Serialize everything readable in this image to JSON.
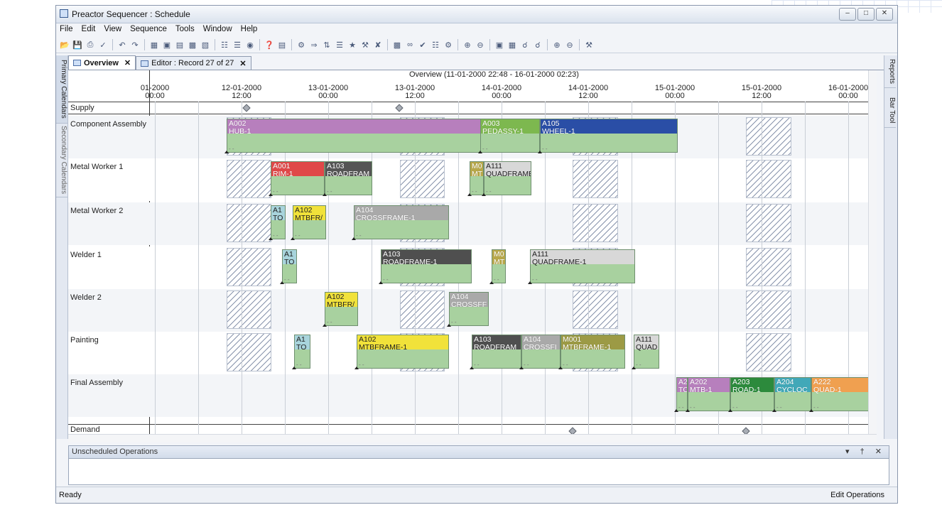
{
  "window": {
    "title": "Preactor Sequencer : Schedule",
    "controls": [
      "–",
      "□",
      "✕"
    ]
  },
  "menu": [
    "File",
    "Edit",
    "View",
    "Sequence",
    "Tools",
    "Window",
    "Help"
  ],
  "side_tabs": {
    "left": [
      "Primary Calendars",
      "Secondary Calendars"
    ],
    "right": [
      "Reports",
      "Bar Tool"
    ]
  },
  "tabs": [
    {
      "label": "Overview",
      "close": "✕"
    },
    {
      "label": "Editor : Record 27 of 27",
      "close": "✕"
    }
  ],
  "overview_header": "Overview   (11-01-2000 22:48 - 16-01-2000 02:23)",
  "time_ticks": [
    {
      "date": "01-2000",
      "time": "00:00"
    },
    {
      "date": "12-01-2000",
      "time": "12:00"
    },
    {
      "date": "13-01-2000",
      "time": "00:00"
    },
    {
      "date": "13-01-2000",
      "time": "12:00"
    },
    {
      "date": "14-01-2000",
      "time": "00:00"
    },
    {
      "date": "14-01-2000",
      "time": "12:00"
    },
    {
      "date": "15-01-2000",
      "time": "00:00"
    },
    {
      "date": "15-01-2000",
      "time": "12:00"
    },
    {
      "date": "16-01-2000",
      "time": "00:00"
    }
  ],
  "rows": {
    "supply": "Supply",
    "demand": "Demand",
    "resources": [
      "Component Assembly",
      "Metal Worker 1",
      "Metal Worker 2",
      "Welder 1",
      "Welder 2",
      "Painting",
      "Final Assembly"
    ]
  },
  "colors": {
    "accent": "#4d6fa6",
    "op_green": "#a8d19f"
  },
  "operations": [
    {
      "row": 0,
      "l1": "A002",
      "l2": "HUB-1",
      "color": "#b77fbd"
    },
    {
      "row": 0,
      "l1": "A003",
      "l2": "PEDASSY-1",
      "color": "#7db84f"
    },
    {
      "row": 0,
      "l1": "A105",
      "l2": "WHEEL-1",
      "color": "#2a4ea6"
    },
    {
      "row": 1,
      "l1": "A001",
      "l2": "RIM-1",
      "color": "#e04848"
    },
    {
      "row": 1,
      "l1": "A103",
      "l2": "ROADFRAM",
      "color": "#555555"
    },
    {
      "row": 1,
      "l1": "M0",
      "l2": "MT",
      "color": "#b8a84a"
    },
    {
      "row": 1,
      "l1": "A111",
      "l2": "QUADFRAME",
      "color": "#d8d8d8",
      "dark": true
    },
    {
      "row": 2,
      "l1": "A1",
      "l2": "TO",
      "color": "#a8d4dc",
      "dark": true
    },
    {
      "row": 2,
      "l1": "A102",
      "l2": "MTBFR/",
      "color": "#f1e23a",
      "dark": true
    },
    {
      "row": 2,
      "l1": "A104",
      "l2": "CROSSFRAME-1",
      "color": "#a9a9a9"
    },
    {
      "row": 3,
      "l1": "A1",
      "l2": "TO",
      "color": "#a8d4dc",
      "dark": true
    },
    {
      "row": 3,
      "l1": "A103",
      "l2": "ROADFRAME-1",
      "color": "#4f4f4f"
    },
    {
      "row": 3,
      "l1": "M0",
      "l2": "MT",
      "color": "#b8a84a"
    },
    {
      "row": 3,
      "l1": "A111",
      "l2": "QUADFRAME-1",
      "color": "#d8d8d8",
      "dark": true
    },
    {
      "row": 4,
      "l1": "A102",
      "l2": "MTBFR/",
      "color": "#f1e23a",
      "dark": true
    },
    {
      "row": 4,
      "l1": "A104",
      "l2": "CROSSFF",
      "color": "#a9a9a9"
    },
    {
      "row": 5,
      "l1": "A1",
      "l2": "TO",
      "color": "#a8d4dc",
      "dark": true
    },
    {
      "row": 5,
      "l1": "A102",
      "l2": "MTBFRAME-1",
      "color": "#f1e23a",
      "dark": true
    },
    {
      "row": 5,
      "l1": "A103",
      "l2": "ROADFRAM",
      "color": "#4f4f4f"
    },
    {
      "row": 5,
      "l1": "A104",
      "l2": "CROSSFI",
      "color": "#a9a9a9"
    },
    {
      "row": 5,
      "l1": "M001",
      "l2": "MTBFRAME-1",
      "color": "#9c9a45"
    },
    {
      "row": 5,
      "l1": "A111",
      "l2": "QUAD",
      "color": "#d8d8d8",
      "dark": true
    },
    {
      "row": 6,
      "l1": "A2",
      "l2": "TC",
      "color": "#b77fbd"
    },
    {
      "row": 6,
      "l1": "A202",
      "l2": "MTB-1",
      "color": "#b77fbd"
    },
    {
      "row": 6,
      "l1": "A203",
      "l2": "ROAD-1",
      "color": "#2c8a3c"
    },
    {
      "row": 6,
      "l1": "A204",
      "l2": "CYCLOC",
      "color": "#41a8b8"
    },
    {
      "row": 6,
      "l1": "A222",
      "l2": "QUAD-1",
      "color": "#f0a050"
    }
  ],
  "unscheduled_panel": {
    "title": "Unscheduled Operations",
    "controls": "▾ † ✕"
  },
  "status": {
    "left": "Ready",
    "right": "Edit Operations"
  }
}
